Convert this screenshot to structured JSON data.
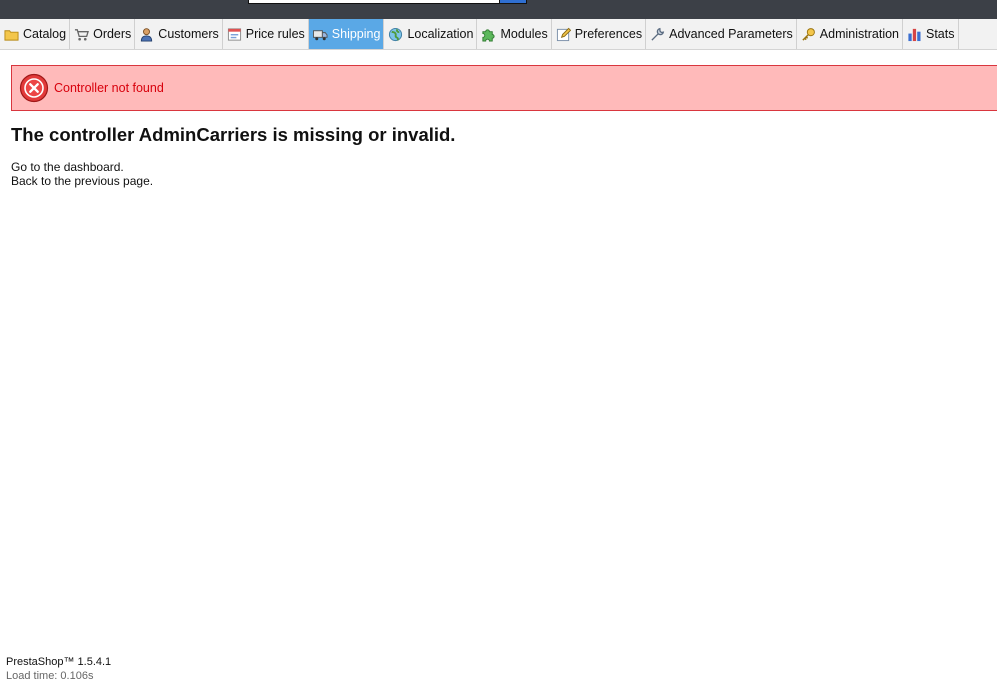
{
  "tabs": [
    {
      "label": "Catalog",
      "icon": "folder-icon"
    },
    {
      "label": "Orders",
      "icon": "cart-icon"
    },
    {
      "label": "Customers",
      "icon": "user-icon"
    },
    {
      "label": "Price rules",
      "icon": "price-tag-icon"
    },
    {
      "label": "Shipping",
      "icon": "truck-icon",
      "active": true
    },
    {
      "label": "Localization",
      "icon": "globe-icon"
    },
    {
      "label": "Modules",
      "icon": "puzzle-icon"
    },
    {
      "label": "Preferences",
      "icon": "edit-icon"
    },
    {
      "label": "Advanced Parameters",
      "icon": "wrench-icon"
    },
    {
      "label": "Administration",
      "icon": "key-icon"
    },
    {
      "label": "Stats",
      "icon": "bar-chart-icon"
    }
  ],
  "error": {
    "message": "Controller not found"
  },
  "main": {
    "heading": "The controller AdminCarriers is missing or invalid.",
    "dashboard_link": "Go to the dashboard.",
    "back_link": "Back to the previous page."
  },
  "footer": {
    "version": "PrestaShop™ 1.5.4.1",
    "load_time": "Load time: 0.106s"
  },
  "colors": {
    "active_tab": "#5aa8e6",
    "error_bg": "#ffbaba",
    "error_border": "#d9363e",
    "error_text": "#d8000c",
    "header": "#3c4047"
  }
}
